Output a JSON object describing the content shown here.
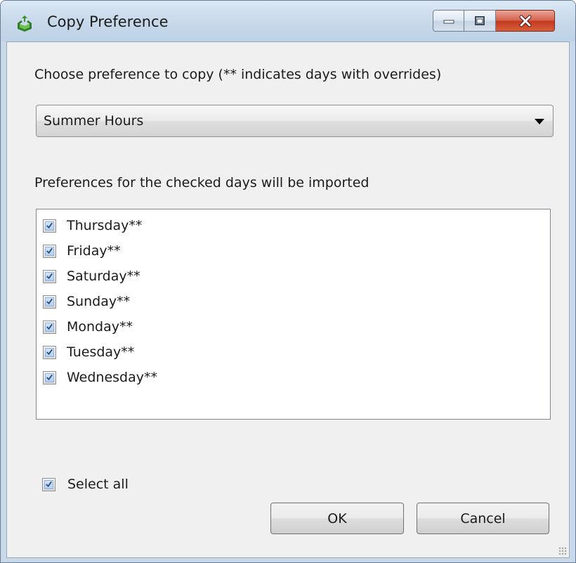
{
  "window": {
    "title": "Copy Preference",
    "icon": "copy-preference-app-icon",
    "controls": {
      "minimize_icon": "minimize-icon",
      "maximize_icon": "maximize-icon",
      "close_icon": "close-icon"
    }
  },
  "prompt": {
    "label": "Choose preference to copy (** indicates days with overrides)"
  },
  "preference_select": {
    "value": "Summer Hours",
    "icon": "chevron-down-icon"
  },
  "days": {
    "label": "Preferences for the checked days will be imported",
    "items": [
      {
        "label": "Thursday**",
        "checked": true
      },
      {
        "label": "Friday**",
        "checked": true
      },
      {
        "label": "Saturday**",
        "checked": true
      },
      {
        "label": "Sunday**",
        "checked": true
      },
      {
        "label": "Monday**",
        "checked": true
      },
      {
        "label": "Tuesday**",
        "checked": true
      },
      {
        "label": "Wednesday**",
        "checked": true
      }
    ]
  },
  "select_all": {
    "label": "Select all",
    "checked": true
  },
  "buttons": {
    "ok": "OK",
    "cancel": "Cancel"
  },
  "colors": {
    "titlebar": "#c7d8ea",
    "dialog_bg": "#f0f0f0",
    "close_button": "#c23a20",
    "checkmark": "#2c4c7a"
  }
}
